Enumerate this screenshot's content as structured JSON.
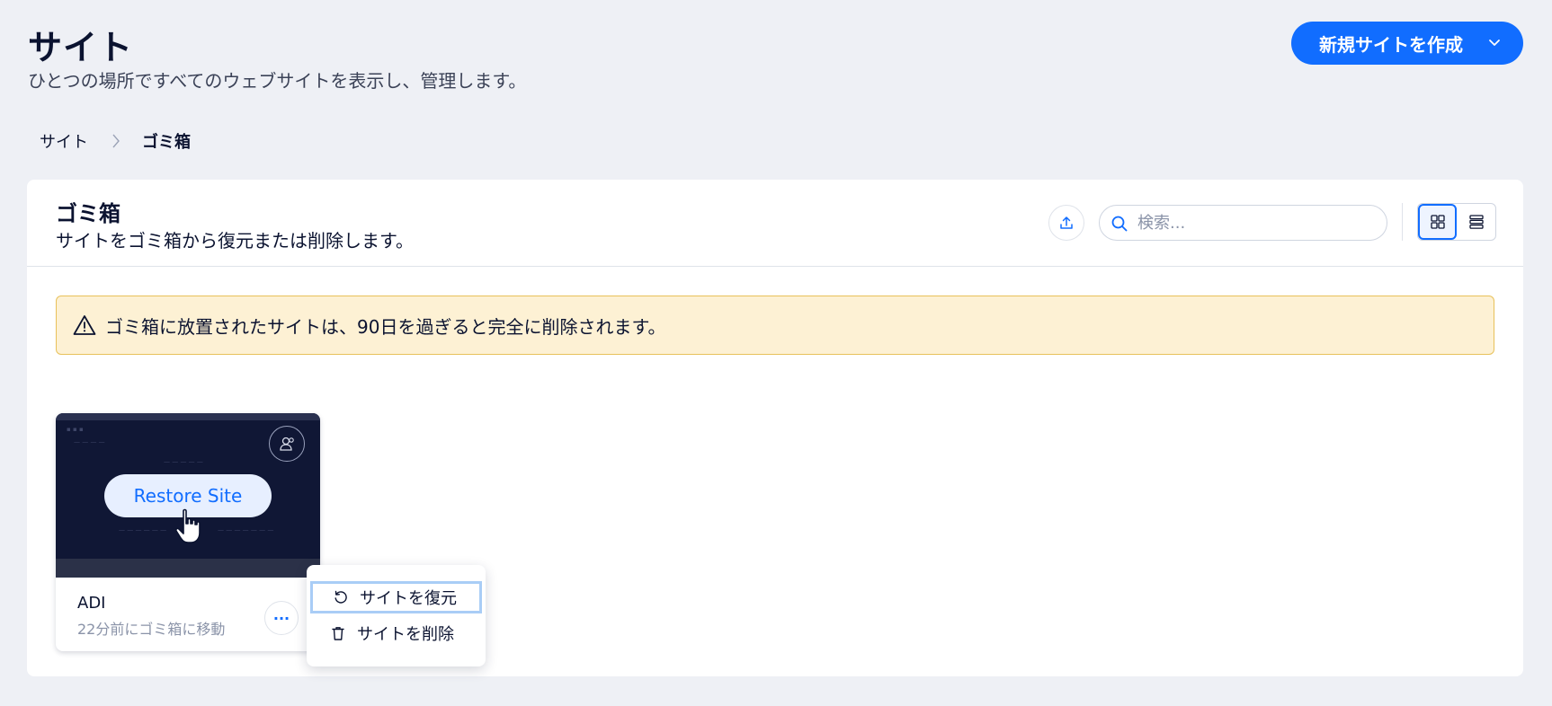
{
  "header": {
    "title": "サイト",
    "subtitle": "ひとつの場所ですべてのウェブサイトを表示し、管理します。",
    "create_button_label": "新規サイトを作成"
  },
  "breadcrumb": {
    "root": "サイト",
    "current": "ゴミ箱"
  },
  "panel": {
    "title": "ゴミ箱",
    "subtitle": "サイトをゴミ箱から復元または削除します。",
    "search_placeholder": "検索..."
  },
  "warning": {
    "text": "ゴミ箱に放置されたサイトは、90日を過ぎると完全に削除されます。"
  },
  "site_card": {
    "name": "ADI",
    "meta": "22分前にゴミ箱に移動",
    "hover_button_label": "Restore Site",
    "more_label": "···"
  },
  "context_menu": {
    "items": [
      {
        "label": "サイトを復元",
        "icon": "restore-icon"
      },
      {
        "label": "サイトを削除",
        "icon": "trash-icon"
      }
    ]
  },
  "colors": {
    "accent": "#116dff",
    "background": "#eef0f5",
    "warning_bg": "#fdf1d4",
    "warning_border": "#e8c15a"
  }
}
